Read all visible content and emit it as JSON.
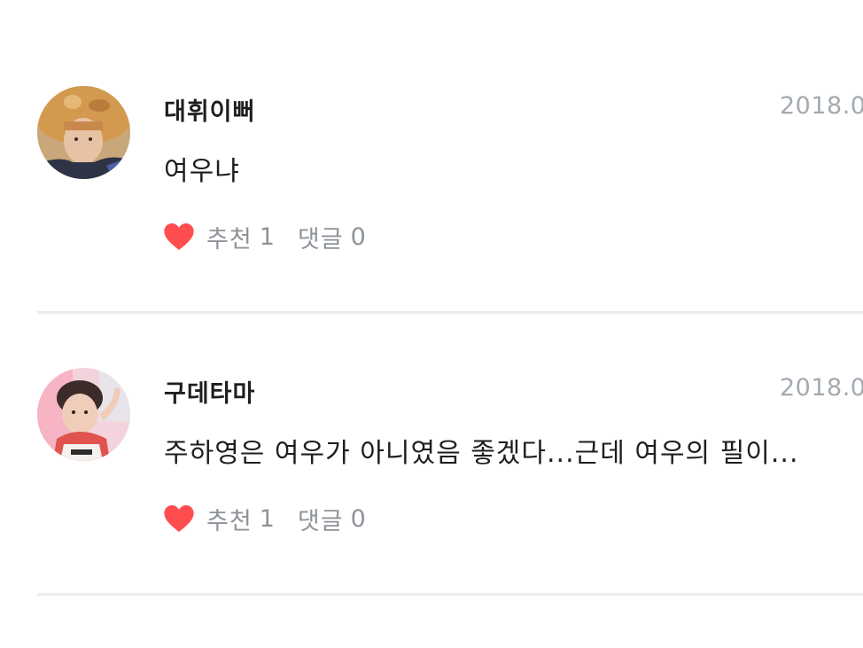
{
  "comments": [
    {
      "author": "대휘이뻐",
      "date": "2018.0",
      "text": "여우냐",
      "like_label": "추천",
      "like_count": "1",
      "reply_label": "댓글",
      "reply_count": "0",
      "avatar_icon": "profile-photo"
    },
    {
      "author": "구데타마",
      "date": "2018.0",
      "text": "주하영은 여우가 아니였음 좋겠다...근데 여우의 필이...",
      "like_label": "추천",
      "like_count": "1",
      "reply_label": "댓글",
      "reply_count": "0",
      "avatar_icon": "profile-photo"
    }
  ],
  "icons": {
    "like": "heart-icon"
  },
  "colors": {
    "heart": "#ff4d4f",
    "meta_text": "#8d9399",
    "date_text": "#a4aab0",
    "divider": "#ebeced"
  }
}
